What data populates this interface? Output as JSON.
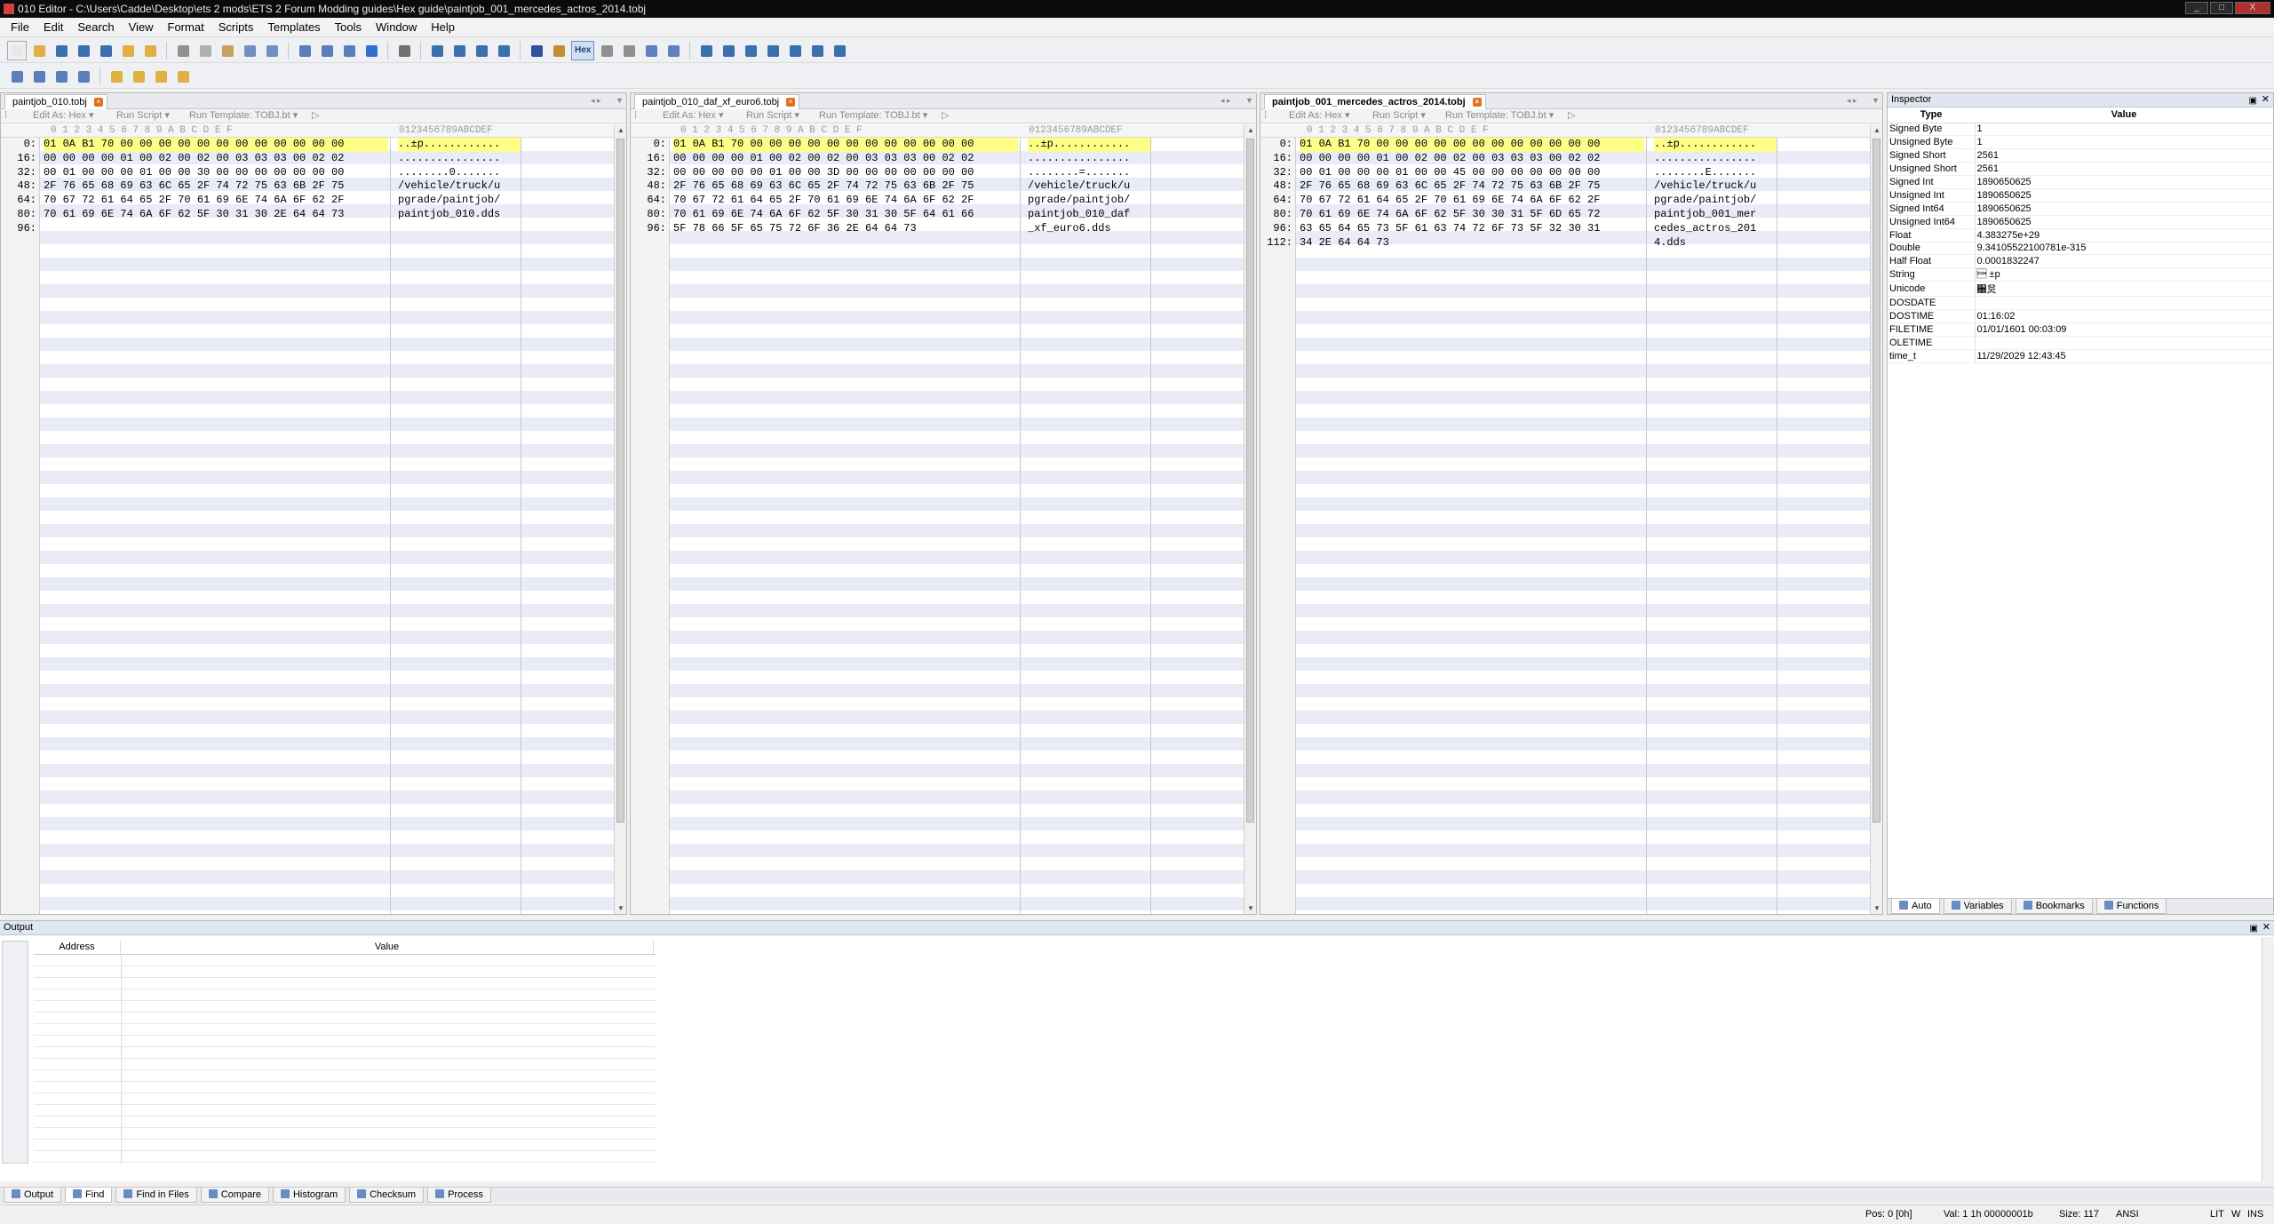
{
  "window": {
    "title": "010 Editor - C:\\Users\\Cadde\\Desktop\\ets 2 mods\\ETS 2 Forum Modding guides\\Hex guide\\paintjob_001_mercedes_actros_2014.tobj",
    "min": "_",
    "max": "□",
    "close": "X"
  },
  "menu": [
    "File",
    "Edit",
    "Search",
    "View",
    "Format",
    "Scripts",
    "Templates",
    "Tools",
    "Window",
    "Help"
  ],
  "toolbar": {
    "hex_label": "Hex"
  },
  "subbar": {
    "edit_as": "Edit As: Hex ▾",
    "run_script": "Run Script ▾",
    "run_template": "Run Template: TOBJ.bt ▾"
  },
  "hex_header": {
    "cols": "0  1  2  3  4  5  6  7  8  9  A  B  C  D  E  F",
    "ascii": "0123456789ABCDEF"
  },
  "panels": [
    {
      "tab": "paintjob_010.tobj",
      "addrs": [
        "0:",
        "16:",
        "32:",
        "48:",
        "64:",
        "80:",
        "96:"
      ],
      "hex": [
        "01 0A B1 70 00 00 00 00 00 00 00 00 00 00 00 00",
        "00 00 00 00 01 00 02 00 02 00 03 03 03 00 02 02",
        "00 01 00 00 00 01 00 00 30 00 00 00 00 00 00 00",
        "2F 76 65 68 69 63 6C 65 2F 74 72 75 63 6B 2F 75",
        "70 67 72 61 64 65 2F 70 61 69 6E 74 6A 6F 62 2F",
        "70 61 69 6E 74 6A 6F 62 5F 30 31 30 2E 64 64 73",
        ""
      ],
      "ascii": [
        "..±p............",
        "................",
        "........0.......",
        "/vehicle/truck/u",
        "pgrade/paintjob/",
        "paintjob_010.dds",
        ""
      ]
    },
    {
      "tab": "paintjob_010_daf_xf_euro6.tobj",
      "addrs": [
        "0:",
        "16:",
        "32:",
        "48:",
        "64:",
        "80:",
        "96:"
      ],
      "hex": [
        "01 0A B1 70 00 00 00 00 00 00 00 00 00 00 00 00",
        "00 00 00 00 01 00 02 00 02 00 03 03 03 00 02 02",
        "00 00 00 00 00 01 00 00 3D 00 00 00 00 00 00 00",
        "2F 76 65 68 69 63 6C 65 2F 74 72 75 63 6B 2F 75",
        "70 67 72 61 64 65 2F 70 61 69 6E 74 6A 6F 62 2F",
        "70 61 69 6E 74 6A 6F 62 5F 30 31 30 5F 64 61 66",
        "5F 78 66 5F 65 75 72 6F 36 2E 64 64 73"
      ],
      "ascii": [
        "..±p............",
        "................",
        "........=.......",
        "/vehicle/truck/u",
        "pgrade/paintjob/",
        "paintjob_010_daf",
        "_xf_euro6.dds"
      ]
    },
    {
      "tab": "paintjob_001_mercedes_actros_2014.tobj",
      "addrs": [
        "0:",
        "16:",
        "32:",
        "48:",
        "64:",
        "80:",
        "96:",
        "112:"
      ],
      "hex": [
        "01 0A B1 70 00 00 00 00 00 00 00 00 00 00 00 00",
        "00 00 00 00 01 00 02 00 02 00 03 03 03 00 02 02",
        "00 01 00 00 00 01 00 00 45 00 00 00 00 00 00 00",
        "2F 76 65 68 69 63 6C 65 2F 74 72 75 63 6B 2F 75",
        "70 67 72 61 64 65 2F 70 61 69 6E 74 6A 6F 62 2F",
        "70 61 69 6E 74 6A 6F 62 5F 30 30 31 5F 6D 65 72",
        "63 65 64 65 73 5F 61 63 74 72 6F 73 5F 32 30 31",
        "34 2E 64 64 73"
      ],
      "ascii": [
        "..±p............",
        "................",
        "........E.......",
        "/vehicle/truck/u",
        "pgrade/paintjob/",
        "paintjob_001_mer",
        "cedes_actros_201",
        "4.dds"
      ]
    }
  ],
  "inspector": {
    "title": "Inspector",
    "col_type": "Type",
    "col_value": "Value",
    "rows": [
      [
        "Signed Byte",
        "1"
      ],
      [
        "Unsigned Byte",
        "1"
      ],
      [
        "Signed Short",
        "2561"
      ],
      [
        "Unsigned Short",
        "2561"
      ],
      [
        "Signed Int",
        "1890650625"
      ],
      [
        "Unsigned Int",
        "1890650625"
      ],
      [
        "Signed Int64",
        "1890650625"
      ],
      [
        "Unsigned Int64",
        "1890650625"
      ],
      [
        "Float",
        "4.383275e+29"
      ],
      [
        "Double",
        "9.34105522100781e-315"
      ],
      [
        "Half Float",
        "0.0001832247"
      ],
      [
        "String",
        "\u0001\n±p"
      ],
      [
        "Unicode",
        "਀炱"
      ],
      [
        "DOSDATE",
        ""
      ],
      [
        "DOSTIME",
        "01:16:02"
      ],
      [
        "FILETIME",
        "01/01/1601 00:03:09"
      ],
      [
        "OLETIME",
        ""
      ],
      [
        "time_t",
        "11/29/2029 12:43:45"
      ]
    ],
    "tabs": [
      "Auto",
      "Variables",
      "Bookmarks",
      "Functions"
    ]
  },
  "output": {
    "title": "Output",
    "col_address": "Address",
    "col_value": "Value",
    "tabs": [
      "Output",
      "Find",
      "Find in Files",
      "Compare",
      "Histogram",
      "Checksum",
      "Process"
    ]
  },
  "status": {
    "pos": "Pos: 0 [0h]",
    "val": "Val: 1 1h 00000001b",
    "size": "Size: 117",
    "encoding": "ANSI",
    "lit": "LIT",
    "w": "W",
    "ins": "INS"
  }
}
